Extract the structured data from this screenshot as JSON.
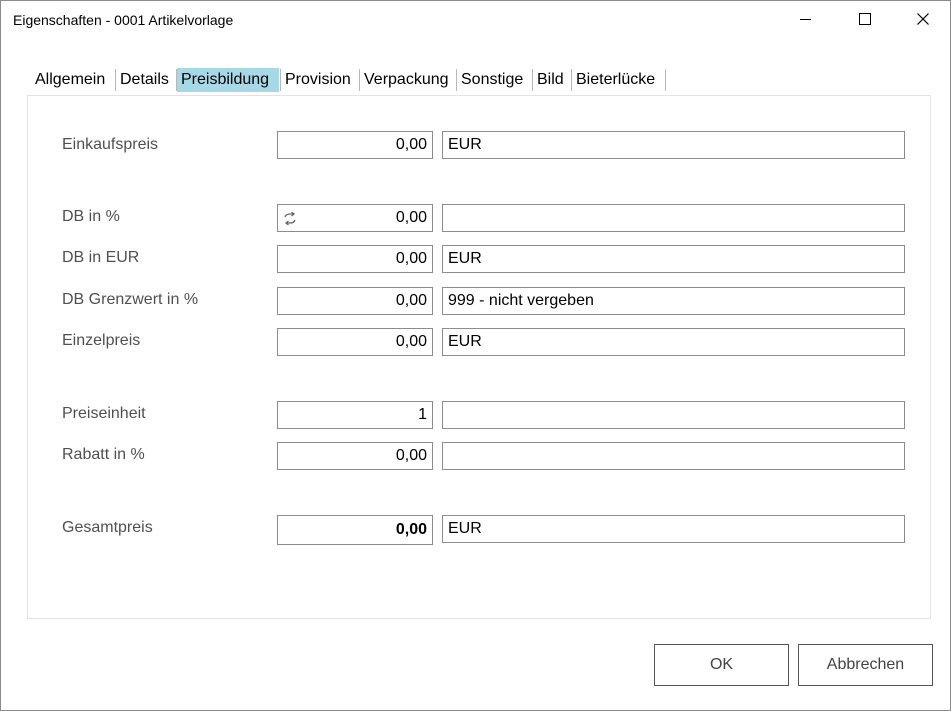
{
  "window": {
    "title": "Eigenschaften - 0001 Artikelvorlage"
  },
  "tabs": [
    {
      "label": "Allgemein",
      "active": false
    },
    {
      "label": "Details",
      "active": false
    },
    {
      "label": "Preisbildung",
      "active": true
    },
    {
      "label": "Provision",
      "active": false
    },
    {
      "label": "Verpackung",
      "active": false
    },
    {
      "label": "Sonstige",
      "active": false
    },
    {
      "label": "Bild",
      "active": false
    },
    {
      "label": "Bieterlücke",
      "active": false
    }
  ],
  "form": {
    "einkaufspreis": {
      "label": "Einkaufspreis",
      "value": "0,00",
      "extra": "EUR"
    },
    "db_prozent": {
      "label": "DB in %",
      "value": "0,00",
      "extra": ""
    },
    "db_eur": {
      "label": "DB in EUR",
      "value": "0,00",
      "extra": "EUR"
    },
    "db_grenzwert": {
      "label": "DB Grenzwert in %",
      "value": "0,00",
      "extra": "999 - nicht vergeben"
    },
    "einzelpreis": {
      "label": "Einzelpreis",
      "value": "0,00",
      "extra": "EUR"
    },
    "preiseinheit": {
      "label": "Preiseinheit",
      "value": "1",
      "extra": ""
    },
    "rabatt": {
      "label": "Rabatt in %",
      "value": "0,00",
      "extra": ""
    },
    "gesamtpreis": {
      "label": "Gesamtpreis",
      "value": "0,00",
      "extra": "EUR"
    }
  },
  "buttons": {
    "ok": "OK",
    "cancel": "Abbrechen"
  },
  "colors": {
    "active_tab": "#a7d8e6",
    "label_text": "#505050",
    "field_border": "#8c8c8c"
  },
  "icons": {
    "db_prozent_field": "refresh-icon",
    "titlebar": [
      "minimize-icon",
      "maximize-icon",
      "close-icon"
    ]
  }
}
